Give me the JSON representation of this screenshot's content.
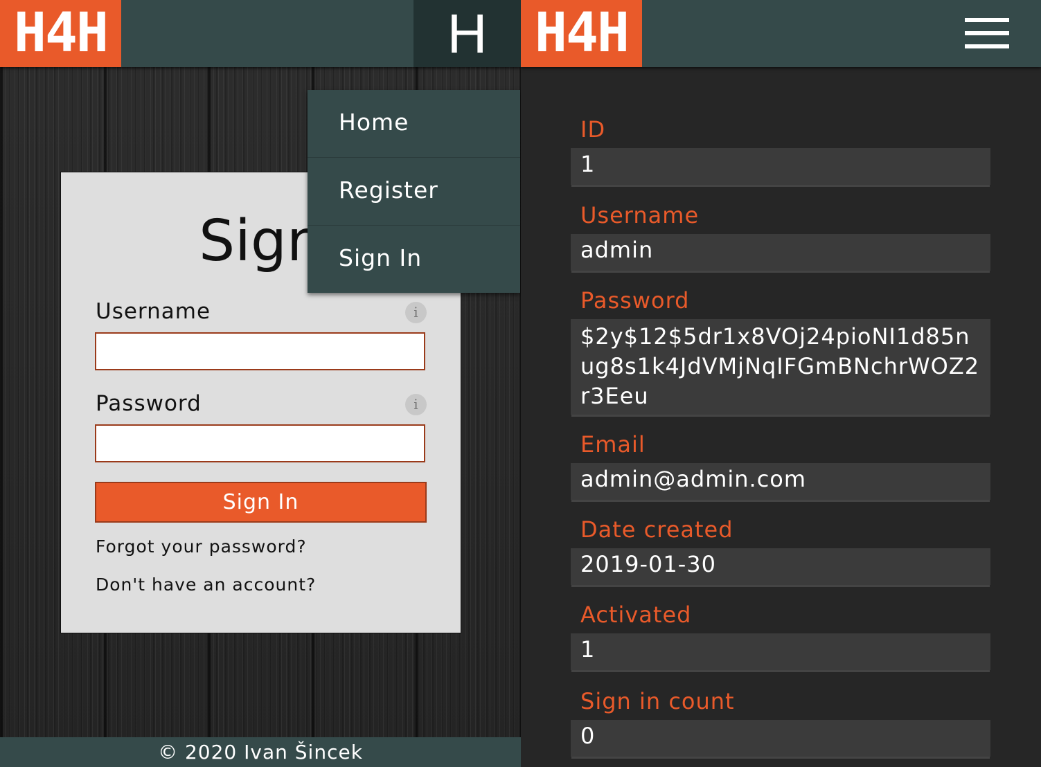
{
  "left": {
    "logo": "H4H",
    "menu_toggle": "H",
    "menu": [
      "Home",
      "Register",
      "Sign In"
    ],
    "form": {
      "title": "Sign",
      "username_label": "Username",
      "password_label": "Password",
      "info_icon": "i",
      "submit": "Sign In",
      "forgot": "Forgot your password?",
      "no_account": "Don't have an account?"
    },
    "footer": "© 2020 Ivan Šincek"
  },
  "right": {
    "logo": "H4H",
    "fields": [
      {
        "label": "ID",
        "value": "1"
      },
      {
        "label": "Username",
        "value": "admin"
      },
      {
        "label": "Password",
        "value": "$2y$12$5dr1x8VOj24pioNI1d85nug8s1k4JdVMjNqIFGmBNchrWOZ2r3Eeu"
      },
      {
        "label": "Email",
        "value": "admin@admin.com"
      },
      {
        "label": "Date created",
        "value": "2019-01-30"
      },
      {
        "label": "Activated",
        "value": "1"
      },
      {
        "label": "Sign in count",
        "value": "0"
      }
    ]
  },
  "colors": {
    "accent": "#e95a2a",
    "bar": "#354a4a",
    "dark": "#262626"
  }
}
